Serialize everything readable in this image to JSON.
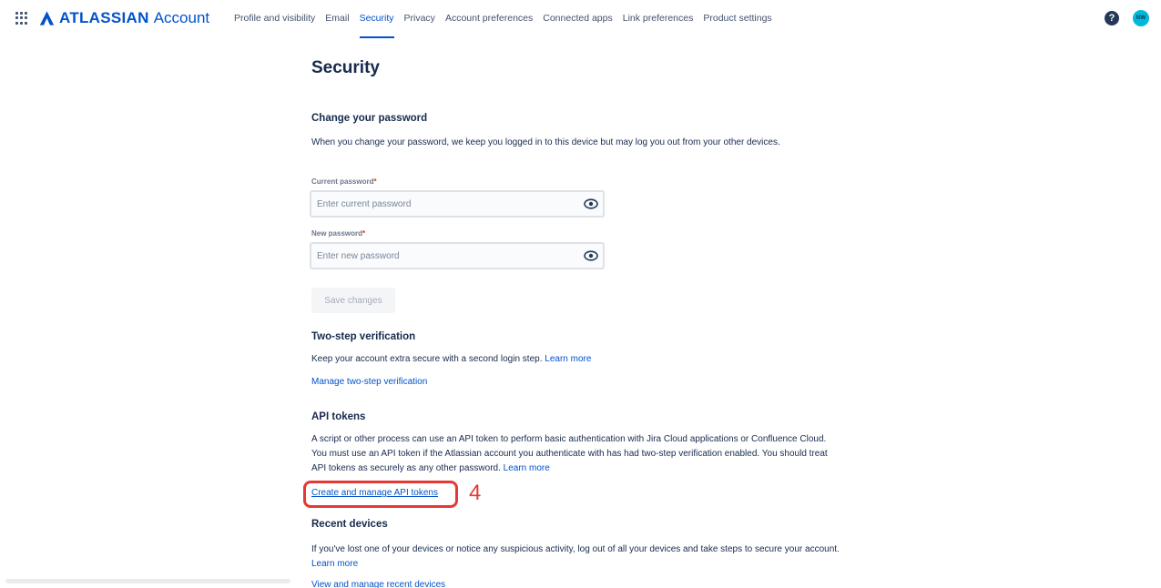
{
  "header": {
    "brand": "ATLASSIAN",
    "product": "Account",
    "tabs": [
      {
        "label": "Profile and visibility"
      },
      {
        "label": "Email"
      },
      {
        "label": "Security"
      },
      {
        "label": "Privacy"
      },
      {
        "label": "Account preferences"
      },
      {
        "label": "Connected apps"
      },
      {
        "label": "Link preferences"
      },
      {
        "label": "Product settings"
      }
    ],
    "active_tab": "Security",
    "help_icon": "?",
    "avatar_initials": "NW"
  },
  "page": {
    "title": "Security"
  },
  "password": {
    "heading": "Change your password",
    "description": "When you change your password, we keep you logged in to this device but may log you out from your other devices.",
    "current_label": "Current password",
    "current_placeholder": "Enter current password",
    "new_label": "New password",
    "new_placeholder": "Enter new password",
    "required_mark": "*",
    "save_label": "Save changes"
  },
  "two_step": {
    "heading": "Two-step verification",
    "description": "Keep your account extra secure with a second login step.",
    "learn_more": "Learn more",
    "manage_link": "Manage two-step verification"
  },
  "api_tokens": {
    "heading": "API tokens",
    "description": "A script or other process can use an API token to perform basic authentication with Jira Cloud applications or Confluence Cloud. You must use an API token if the Atlassian account you authenticate with has had two-step verification enabled. You should treat API tokens as securely as any other password.",
    "learn_more": "Learn more",
    "manage_link": "Create and manage API tokens"
  },
  "recent_devices": {
    "heading": "Recent devices",
    "description": "If you've lost one of your devices or notice any suspicious activity, log out of all your devices and take steps to secure your account.",
    "learn_more": "Learn more",
    "manage_link": "View and manage recent devices"
  },
  "annotation": {
    "step_number": "4",
    "color": "#e53935"
  },
  "colors": {
    "link": "#0052cc",
    "text": "#172b4d",
    "required": "#de350b"
  }
}
